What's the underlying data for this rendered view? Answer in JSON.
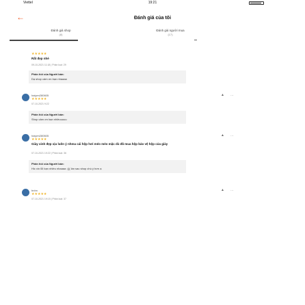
{
  "status_bar": {
    "carrier": "Viettel",
    "time": "19:21"
  },
  "header": {
    "title": "Đánh giá của tôi"
  },
  "tabs": [
    {
      "label": "Đánh giá shop",
      "sub": "(8)"
    },
    {
      "label": "Đánh giá người mua",
      "sub": "(17)"
    }
  ],
  "reviews": [
    {
      "stars": "★★★★★",
      "content": "Rất đẹp nhé",
      "meta": "09-10-2021 11:18 | Phân loại: 29",
      "reply_title": "Phản hồi của Người bán:",
      "reply_content": "Dạ shop cảm ơn bạn nhaaaa"
    },
    {
      "name": "haiyen280605",
      "stars": "★★★★★",
      "meta": "07-10-2021 9:22",
      "reply_title": "Phản hồi của Người bán:",
      "reply_content": "Shop cảm ơn bạn nhiềuuuuu"
    },
    {
      "name": "haiyen280605",
      "stars": "★★★★★",
      "content": "Giày xinh đẹp xịu luôn ý nhma cái hộp hơi méo méo mặc dù đã mua hộp bảo vệ hộp của giày",
      "meta": "07-10-2021 19:22 | Phân loại: 36",
      "reply_title": "Phản hồi của Người bán:",
      "reply_content": "Hic xin lỗi bạn nhiều nhaaaa :((( lần sau shop chú ý hơn ạ"
    },
    {
      "name": "bnhn",
      "stars": "★★★★★",
      "meta": "07-10-2021 19:15 | Phân loại: 37"
    }
  ],
  "colors": {
    "accent": "#f05a28",
    "star": "#f0b429",
    "avatar": "#3a6ea5"
  }
}
